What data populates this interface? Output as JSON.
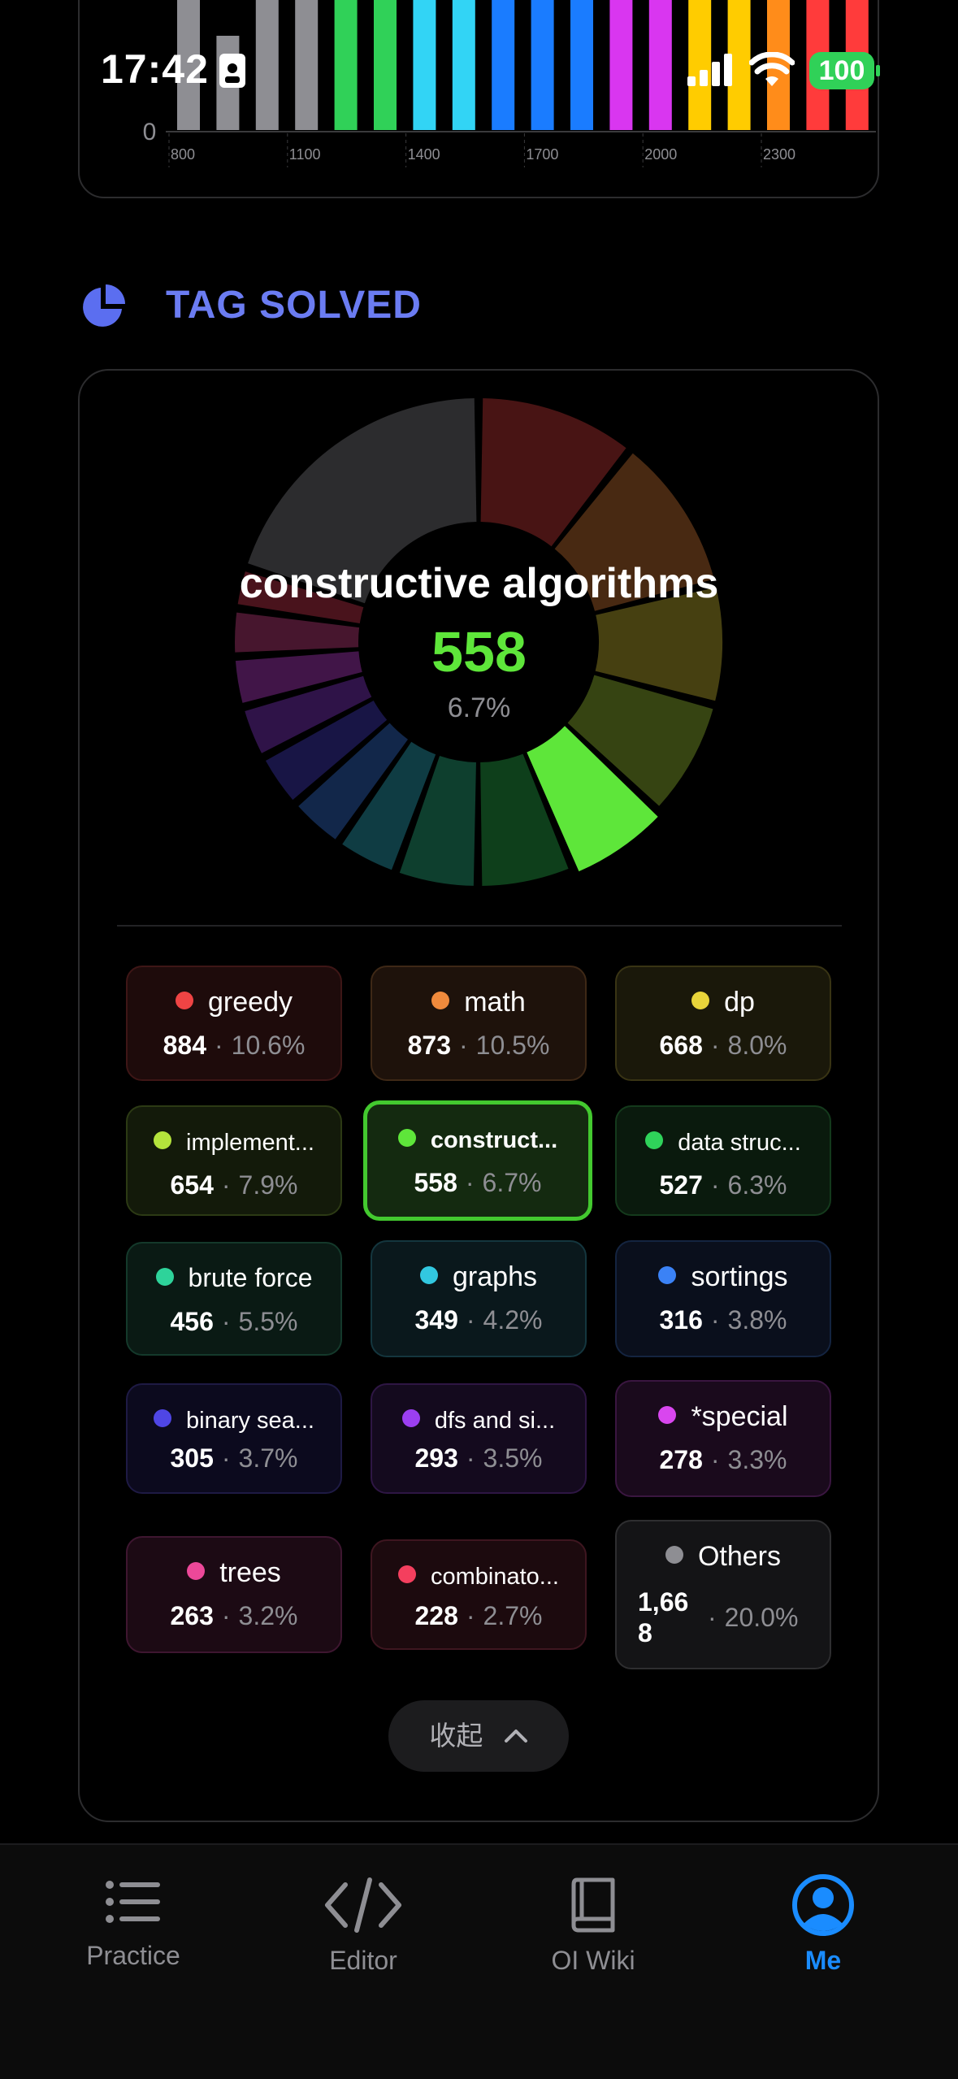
{
  "status_bar": {
    "time": "17:42",
    "battery": "100"
  },
  "rating_chart": {
    "y_zero_label": "0",
    "ticks": [
      "800",
      "1100",
      "1400",
      "1700",
      "2000",
      "2300"
    ],
    "bars": [
      {
        "value": 1.0,
        "color": "#8e8e93"
      },
      {
        "value": 0.58,
        "color": "#8e8e93"
      },
      {
        "value": 0.8,
        "color": "#8e8e93"
      },
      {
        "value": 1.0,
        "color": "#8e8e93"
      },
      {
        "value": 1.0,
        "color": "#30d158"
      },
      {
        "value": 1.0,
        "color": "#30d158"
      },
      {
        "value": 1.0,
        "color": "#32d4f5"
      },
      {
        "value": 1.0,
        "color": "#32d4f5"
      },
      {
        "value": 1.0,
        "color": "#1a7cff"
      },
      {
        "value": 1.0,
        "color": "#1a7cff"
      },
      {
        "value": 1.0,
        "color": "#1a7cff"
      },
      {
        "value": 1.0,
        "color": "#d936f0"
      },
      {
        "value": 1.0,
        "color": "#d936f0"
      },
      {
        "value": 1.0,
        "color": "#ffcc00"
      },
      {
        "value": 1.0,
        "color": "#ffcc00"
      },
      {
        "value": 1.0,
        "color": "#ff8c1a"
      },
      {
        "value": 1.0,
        "color": "#ff3b3b"
      },
      {
        "value": 1.0,
        "color": "#ff3b3b"
      }
    ]
  },
  "section": {
    "title": "TAG SOLVED"
  },
  "donut": {
    "selected_name": "constructive algorithms",
    "selected_count": "558",
    "selected_pct": "6.7%"
  },
  "chart_data": {
    "type": "pie",
    "title": "",
    "slices": [
      {
        "label": "greedy",
        "value": 884,
        "pct": 10.6,
        "color": "#ef4444"
      },
      {
        "label": "math",
        "value": 873,
        "pct": 10.5,
        "color": "#f08a3c"
      },
      {
        "label": "dp",
        "value": 668,
        "pct": 8.0,
        "color": "#e8d43a"
      },
      {
        "label": "implementation",
        "value": 654,
        "pct": 7.9,
        "color": "#b4e33c"
      },
      {
        "label": "constructive algorithms",
        "value": 558,
        "pct": 6.7,
        "color": "#5ee63a"
      },
      {
        "label": "data structures",
        "value": 527,
        "pct": 6.3,
        "color": "#2fd35a"
      },
      {
        "label": "brute force",
        "value": 456,
        "pct": 5.5,
        "color": "#2ed39a"
      },
      {
        "label": "graphs",
        "value": 349,
        "pct": 4.2,
        "color": "#32c8e0"
      },
      {
        "label": "sortings",
        "value": 316,
        "pct": 3.8,
        "color": "#3b82f6"
      },
      {
        "label": "binary search",
        "value": 305,
        "pct": 3.7,
        "color": "#4f46e5"
      },
      {
        "label": "dfs and similar",
        "value": 293,
        "pct": 3.5,
        "color": "#9b3ff0"
      },
      {
        "label": "*special",
        "value": 278,
        "pct": 3.3,
        "color": "#d946ef"
      },
      {
        "label": "trees",
        "value": 263,
        "pct": 3.2,
        "color": "#ec4899"
      },
      {
        "label": "combinatorics",
        "value": 228,
        "pct": 2.7,
        "color": "#f43f5e"
      },
      {
        "label": "Others",
        "value": 1668,
        "pct": 20.0,
        "color": "#8e8e93"
      }
    ]
  },
  "chips": [
    {
      "name": "greedy",
      "count": "884",
      "pct": "10.6%"
    },
    {
      "name": "math",
      "count": "873",
      "pct": "10.5%"
    },
    {
      "name": "dp",
      "count": "668",
      "pct": "8.0%"
    },
    {
      "name": "implement...",
      "count": "654",
      "pct": "7.9%"
    },
    {
      "name": "construct...",
      "count": "558",
      "pct": "6.7%"
    },
    {
      "name": "data struc...",
      "count": "527",
      "pct": "6.3%"
    },
    {
      "name": "brute force",
      "count": "456",
      "pct": "5.5%"
    },
    {
      "name": "graphs",
      "count": "349",
      "pct": "4.2%"
    },
    {
      "name": "sortings",
      "count": "316",
      "pct": "3.8%"
    },
    {
      "name": "binary sea...",
      "count": "305",
      "pct": "3.7%"
    },
    {
      "name": "dfs and si...",
      "count": "293",
      "pct": "3.5%"
    },
    {
      "name": "*special",
      "count": "278",
      "pct": "3.3%"
    },
    {
      "name": "trees",
      "count": "263",
      "pct": "3.2%"
    },
    {
      "name": "combinato...",
      "count": "228",
      "pct": "2.7%"
    },
    {
      "name": "Others",
      "count_line1": "1,66",
      "count_line2": "8",
      "pct": "20.0%"
    }
  ],
  "chip_sep": "·",
  "collapse_button": {
    "label": "收起"
  },
  "tabbar": {
    "practice": "Practice",
    "editor": "Editor",
    "oiwiki": "OI Wiki",
    "me": "Me"
  },
  "colors": {
    "accent": "#1a8cff",
    "section_title": "#6b7cf2",
    "selected": "#5ee63a"
  }
}
